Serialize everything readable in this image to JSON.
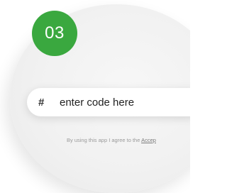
{
  "step": {
    "number": "03",
    "color": "#3aa83f"
  },
  "code_input": {
    "icon": "hash-icon",
    "icon_glyph": "#",
    "placeholder": "enter code here"
  },
  "terms": {
    "text": "By using this app I agree to the ",
    "link_text": "Accep"
  }
}
